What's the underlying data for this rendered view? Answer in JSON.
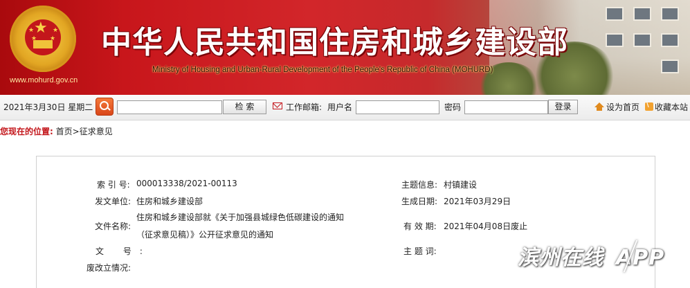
{
  "header": {
    "title": "中华人民共和国住房和城乡建设部",
    "subtitle": "Ministry of Housing and Urban-Rural Development of the People's Republic of China (MOHURD)",
    "url": "www.mohurd.gov.cn"
  },
  "toolbar": {
    "date": "2021年3月30日 星期二",
    "search_button": "检 索",
    "mail_label": "工作邮箱:",
    "username_label": "用户名",
    "password_label": "密码",
    "login_button": "登录",
    "set_home": "设为首页",
    "bookmark": "收藏本站"
  },
  "breadcrumb": {
    "label": "您现在的位置:",
    "home": "首页",
    "sep": ">",
    "current": "征求意见"
  },
  "info": {
    "index_label": "索 引 号:",
    "index_value": "000013338/2021-00113",
    "topic_label": "主题信息:",
    "topic_value": "村镇建设",
    "issuer_label": "发文单位:",
    "issuer_value": "住房和城乡建设部",
    "date_label": "生成日期:",
    "date_value": "2021年03月29日",
    "filename_label": "文件名称:",
    "filename_line1": "住房和城乡建设部就《关于加强县城绿色低碳建设的通知",
    "filename_line2": "（征求意见稿）》公开征求意见的通知",
    "validity_label": "有 效 期:",
    "validity_value": "2021年04月08日废止",
    "docno_label": "文 号:",
    "docno_value": "",
    "keywords_label": "主 题 词:",
    "keywords_value": "",
    "status_label": "废改立情况:",
    "status_value": ""
  },
  "watermark": {
    "text_left": "滨州在线",
    "text_right": "APP"
  },
  "colors": {
    "brand_red": "#c3161b",
    "toolbar_bg": "#ececec"
  },
  "icons": [
    "search-icon",
    "mail-icon",
    "home-icon",
    "bookmark-icon",
    "emblem-icon"
  ]
}
